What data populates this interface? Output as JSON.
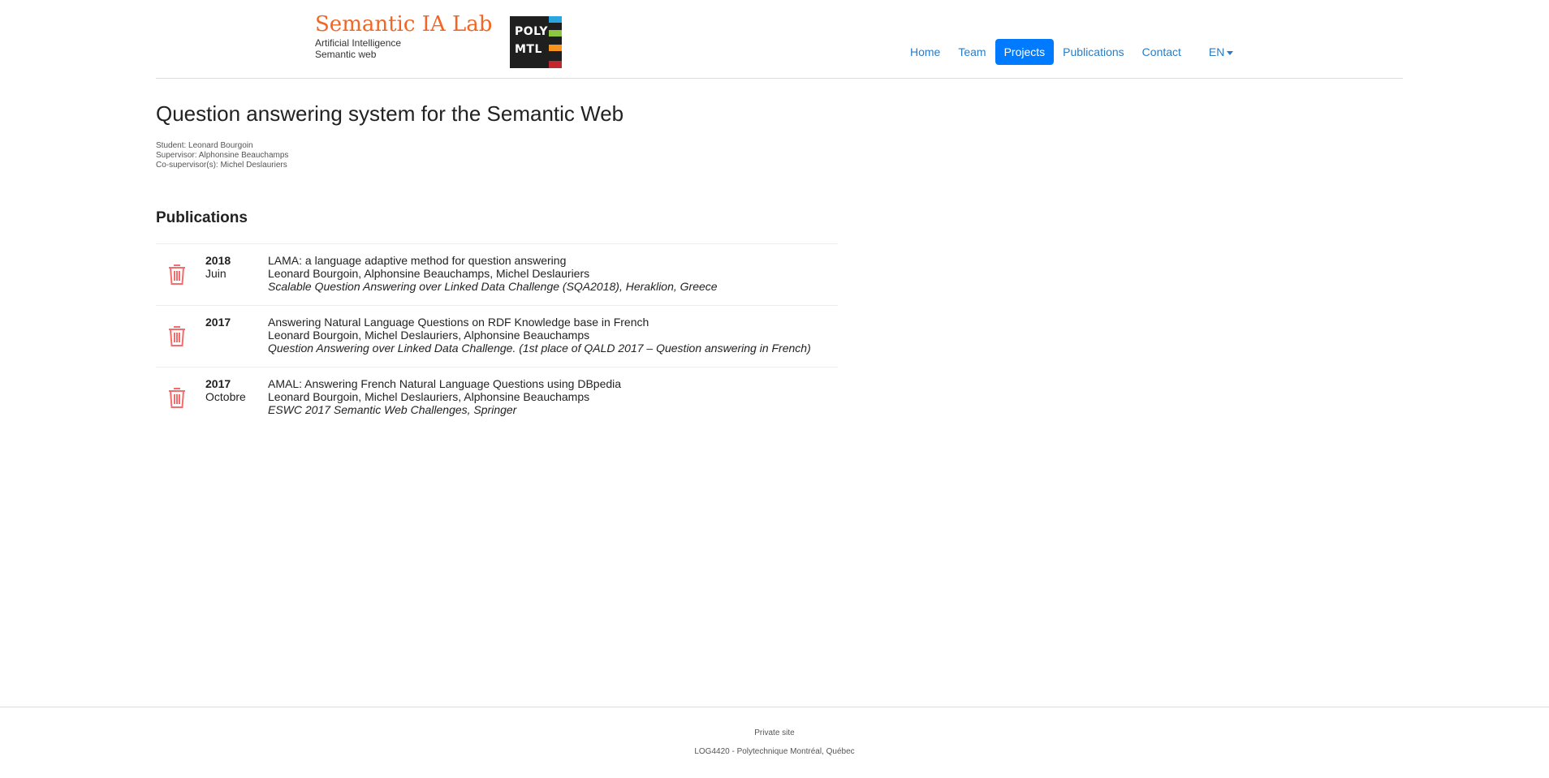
{
  "brand": {
    "title": "Semantic IA Lab",
    "subtitle_1": "Artificial Intelligence",
    "subtitle_2": "Semantic web",
    "logo_line_1": "POLY",
    "logo_line_2": "MTL"
  },
  "nav": {
    "items": [
      {
        "label": "Home",
        "active": false
      },
      {
        "label": "Team",
        "active": false
      },
      {
        "label": "Projects",
        "active": true
      },
      {
        "label": "Publications",
        "active": false
      },
      {
        "label": "Contact",
        "active": false
      }
    ],
    "language": "EN"
  },
  "project": {
    "title": "Question answering system for the Semantic Web",
    "student": "Student: Leonard Bourgoin",
    "supervisor": "Supervisor: Alphonsine Beauchamps",
    "cosupervisor": "Co-supervisor(s): Michel Deslauriers"
  },
  "publications": {
    "heading": "Publications",
    "items": [
      {
        "year": "2018",
        "month": "Juin",
        "title": "LAMA: a language adaptive method for question answering",
        "authors": "Leonard Bourgoin, Alphonsine Beauchamps, Michel Deslauriers",
        "venue": "Scalable Question Answering over Linked Data Challenge (SQA2018), Heraklion, Greece"
      },
      {
        "year": "2017",
        "month": "",
        "title": "Answering Natural Language Questions on RDF Knowledge base in French",
        "authors": "Leonard Bourgoin, Michel Deslauriers, Alphonsine Beauchamps",
        "venue": "Question Answering over Linked Data Challenge. (1st place of QALD 2017 – Question answering in French)"
      },
      {
        "year": "2017",
        "month": "Octobre",
        "title": "AMAL: Answering French Natural Language Questions using DBpedia",
        "authors": "Leonard Bourgoin, Michel Deslauriers, Alphonsine Beauchamps",
        "venue": "ESWC 2017 Semantic Web Challenges, Springer"
      }
    ]
  },
  "footer": {
    "line_1": "Private site",
    "line_2": "LOG4420 - Polytechnique Montréal, Québec"
  },
  "colors": {
    "brand": "#f26522",
    "link": "#2c7cc1",
    "active_nav": "#007bff",
    "trash_icon": "#f26d6d"
  }
}
